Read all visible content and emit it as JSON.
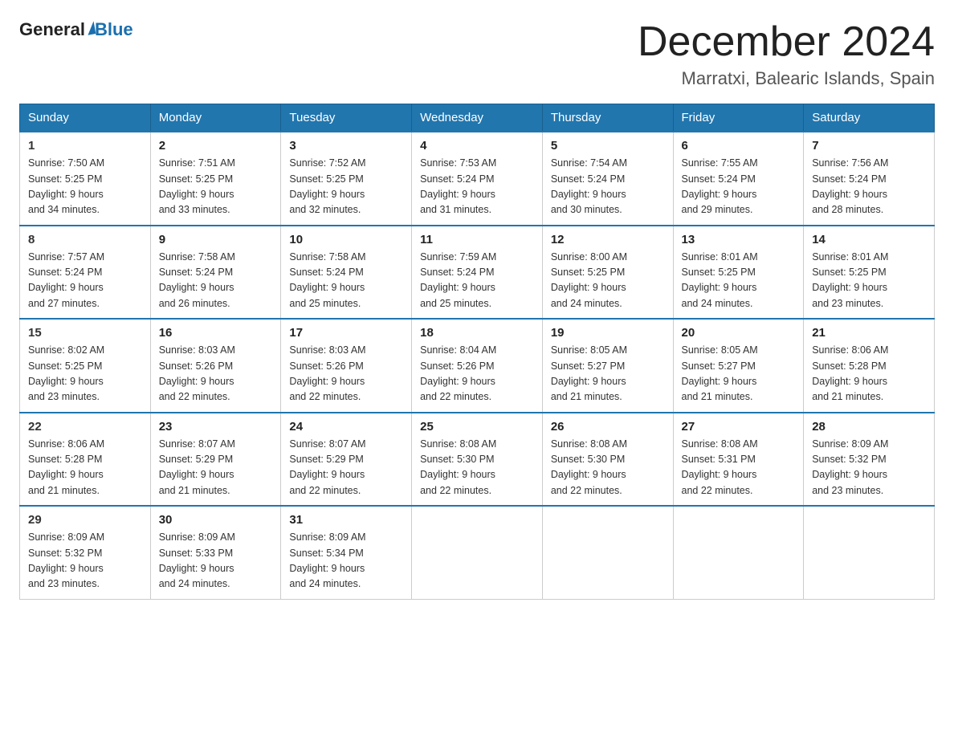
{
  "header": {
    "logo_general": "General",
    "logo_blue": "Blue",
    "month_title": "December 2024",
    "location": "Marratxi, Balearic Islands, Spain"
  },
  "days_of_week": [
    "Sunday",
    "Monday",
    "Tuesday",
    "Wednesday",
    "Thursday",
    "Friday",
    "Saturday"
  ],
  "weeks": [
    [
      {
        "day": "1",
        "sunrise": "7:50 AM",
        "sunset": "5:25 PM",
        "daylight": "9 hours and 34 minutes."
      },
      {
        "day": "2",
        "sunrise": "7:51 AM",
        "sunset": "5:25 PM",
        "daylight": "9 hours and 33 minutes."
      },
      {
        "day": "3",
        "sunrise": "7:52 AM",
        "sunset": "5:25 PM",
        "daylight": "9 hours and 32 minutes."
      },
      {
        "day": "4",
        "sunrise": "7:53 AM",
        "sunset": "5:24 PM",
        "daylight": "9 hours and 31 minutes."
      },
      {
        "day": "5",
        "sunrise": "7:54 AM",
        "sunset": "5:24 PM",
        "daylight": "9 hours and 30 minutes."
      },
      {
        "day": "6",
        "sunrise": "7:55 AM",
        "sunset": "5:24 PM",
        "daylight": "9 hours and 29 minutes."
      },
      {
        "day": "7",
        "sunrise": "7:56 AM",
        "sunset": "5:24 PM",
        "daylight": "9 hours and 28 minutes."
      }
    ],
    [
      {
        "day": "8",
        "sunrise": "7:57 AM",
        "sunset": "5:24 PM",
        "daylight": "9 hours and 27 minutes."
      },
      {
        "day": "9",
        "sunrise": "7:58 AM",
        "sunset": "5:24 PM",
        "daylight": "9 hours and 26 minutes."
      },
      {
        "day": "10",
        "sunrise": "7:58 AM",
        "sunset": "5:24 PM",
        "daylight": "9 hours and 25 minutes."
      },
      {
        "day": "11",
        "sunrise": "7:59 AM",
        "sunset": "5:24 PM",
        "daylight": "9 hours and 25 minutes."
      },
      {
        "day": "12",
        "sunrise": "8:00 AM",
        "sunset": "5:25 PM",
        "daylight": "9 hours and 24 minutes."
      },
      {
        "day": "13",
        "sunrise": "8:01 AM",
        "sunset": "5:25 PM",
        "daylight": "9 hours and 24 minutes."
      },
      {
        "day": "14",
        "sunrise": "8:01 AM",
        "sunset": "5:25 PM",
        "daylight": "9 hours and 23 minutes."
      }
    ],
    [
      {
        "day": "15",
        "sunrise": "8:02 AM",
        "sunset": "5:25 PM",
        "daylight": "9 hours and 23 minutes."
      },
      {
        "day": "16",
        "sunrise": "8:03 AM",
        "sunset": "5:26 PM",
        "daylight": "9 hours and 22 minutes."
      },
      {
        "day": "17",
        "sunrise": "8:03 AM",
        "sunset": "5:26 PM",
        "daylight": "9 hours and 22 minutes."
      },
      {
        "day": "18",
        "sunrise": "8:04 AM",
        "sunset": "5:26 PM",
        "daylight": "9 hours and 22 minutes."
      },
      {
        "day": "19",
        "sunrise": "8:05 AM",
        "sunset": "5:27 PM",
        "daylight": "9 hours and 21 minutes."
      },
      {
        "day": "20",
        "sunrise": "8:05 AM",
        "sunset": "5:27 PM",
        "daylight": "9 hours and 21 minutes."
      },
      {
        "day": "21",
        "sunrise": "8:06 AM",
        "sunset": "5:28 PM",
        "daylight": "9 hours and 21 minutes."
      }
    ],
    [
      {
        "day": "22",
        "sunrise": "8:06 AM",
        "sunset": "5:28 PM",
        "daylight": "9 hours and 21 minutes."
      },
      {
        "day": "23",
        "sunrise": "8:07 AM",
        "sunset": "5:29 PM",
        "daylight": "9 hours and 21 minutes."
      },
      {
        "day": "24",
        "sunrise": "8:07 AM",
        "sunset": "5:29 PM",
        "daylight": "9 hours and 22 minutes."
      },
      {
        "day": "25",
        "sunrise": "8:08 AM",
        "sunset": "5:30 PM",
        "daylight": "9 hours and 22 minutes."
      },
      {
        "day": "26",
        "sunrise": "8:08 AM",
        "sunset": "5:30 PM",
        "daylight": "9 hours and 22 minutes."
      },
      {
        "day": "27",
        "sunrise": "8:08 AM",
        "sunset": "5:31 PM",
        "daylight": "9 hours and 22 minutes."
      },
      {
        "day": "28",
        "sunrise": "8:09 AM",
        "sunset": "5:32 PM",
        "daylight": "9 hours and 23 minutes."
      }
    ],
    [
      {
        "day": "29",
        "sunrise": "8:09 AM",
        "sunset": "5:32 PM",
        "daylight": "9 hours and 23 minutes."
      },
      {
        "day": "30",
        "sunrise": "8:09 AM",
        "sunset": "5:33 PM",
        "daylight": "9 hours and 24 minutes."
      },
      {
        "day": "31",
        "sunrise": "8:09 AM",
        "sunset": "5:34 PM",
        "daylight": "9 hours and 24 minutes."
      },
      null,
      null,
      null,
      null
    ]
  ],
  "labels": {
    "sunrise": "Sunrise:",
    "sunset": "Sunset:",
    "daylight": "Daylight:"
  }
}
